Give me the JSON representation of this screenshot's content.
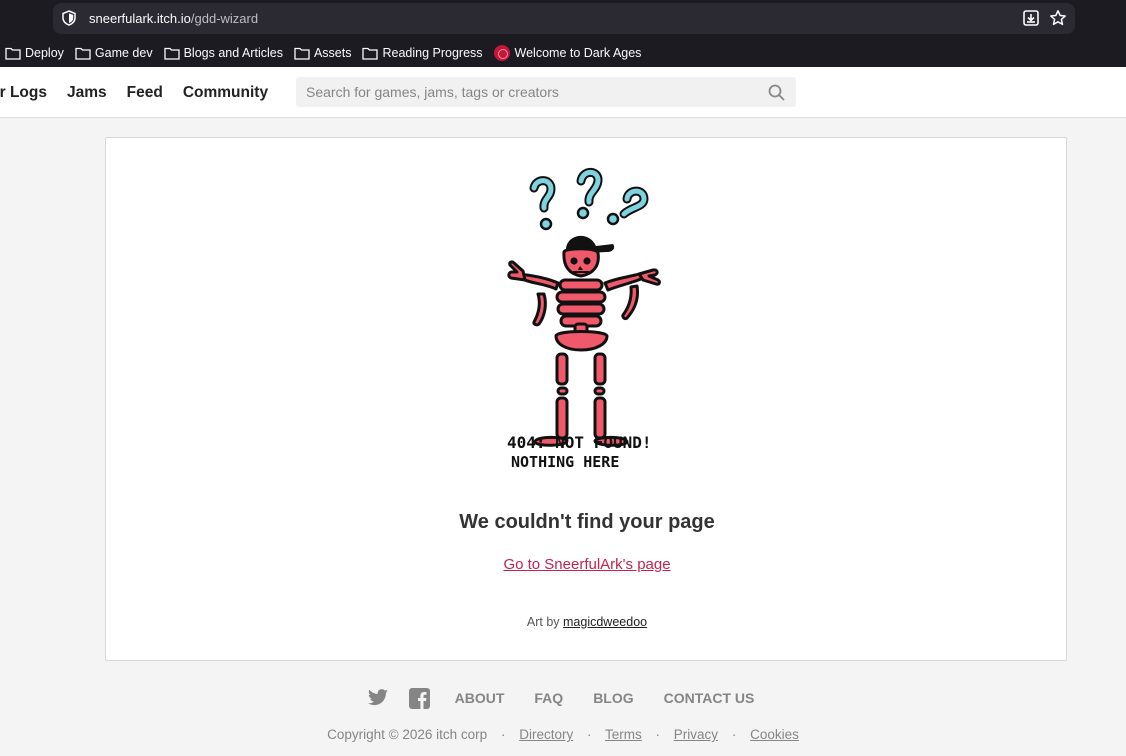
{
  "browser": {
    "url_host": "sneerfulark.itch.io",
    "url_path": "/gdd-wizard",
    "bookmarks": [
      "Deploy",
      "Game dev",
      "Blogs and Articles",
      "Assets",
      "Reading Progress",
      "Welcome to Dark Ages"
    ]
  },
  "header": {
    "nav": [
      "er Logs",
      "Jams",
      "Feed",
      "Community"
    ],
    "search_placeholder": "Search for games, jams, tags or creators"
  },
  "error": {
    "art_line1": "404: NOT FOUND!",
    "art_line2": "NOTHING HERE",
    "title": "We couldn't find your page",
    "link": "Go to SneerfulArk's page",
    "credit_prefix": "Art by",
    "credit_name": "magicdweedoo"
  },
  "footer": {
    "links": [
      "ABOUT",
      "FAQ",
      "BLOG",
      "CONTACT US"
    ],
    "copyright": "Copyright © 2026 itch corp",
    "bottom_links": [
      "Directory",
      "Terms",
      "Privacy",
      "Cookies"
    ],
    "icons": [
      "twitter-icon",
      "facebook-icon"
    ]
  },
  "colors": {
    "link_accent": "#c1234e",
    "skeleton_red": "#f0596a",
    "question_blue": "#7fd3e0"
  }
}
